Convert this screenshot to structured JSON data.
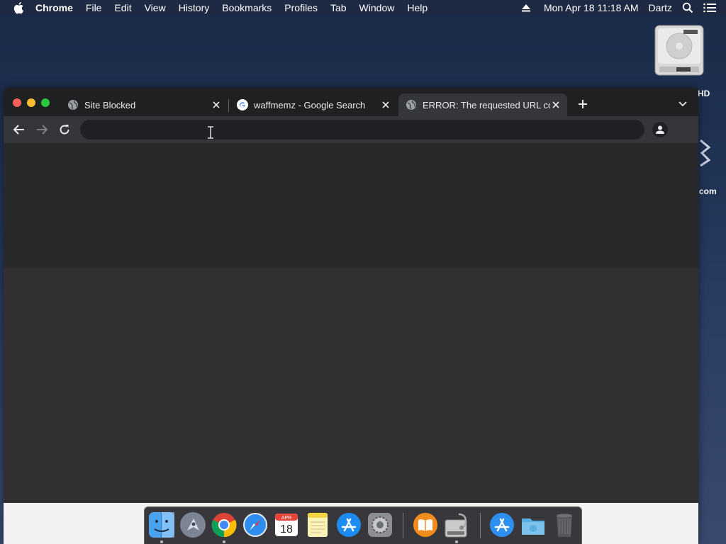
{
  "menubar": {
    "app_name": "Chrome",
    "items": [
      "File",
      "Edit",
      "View",
      "History",
      "Bookmarks",
      "Profiles",
      "Tab",
      "Window",
      "Help"
    ],
    "clock": "Mon Apr 18  11:18 AM",
    "user": "Dartz"
  },
  "desktop": {
    "hd_label": "HD",
    "label2": "com"
  },
  "browser": {
    "tabs": [
      {
        "title": "Site Blocked",
        "icon": "globe-icon",
        "active": false
      },
      {
        "title": "waffmemz - Google Search",
        "icon": "google-icon",
        "active": false
      },
      {
        "title": "ERROR: The requested URL co",
        "icon": "globe-icon",
        "active": true
      }
    ],
    "omnibox": {
      "value": "",
      "placeholder": ""
    }
  },
  "dock": {
    "items": [
      {
        "name": "finder",
        "running": true
      },
      {
        "name": "launchpad",
        "running": false
      },
      {
        "name": "chrome",
        "running": true
      },
      {
        "name": "safari",
        "running": false
      },
      {
        "name": "calendar",
        "month": "APR",
        "day": "18",
        "running": false
      },
      {
        "name": "notes",
        "running": false
      },
      {
        "name": "app-store",
        "running": false
      },
      {
        "name": "system-preferences",
        "running": false
      },
      {
        "name": "books",
        "running": false
      },
      {
        "name": "disk-utility",
        "running": true
      },
      {
        "name": "app-store-folder",
        "running": false
      },
      {
        "name": "downloads-folder",
        "running": false
      },
      {
        "name": "trash",
        "running": false
      }
    ]
  },
  "colors": {
    "traffic_red": "#fe5f57",
    "traffic_yellow": "#febc2e",
    "traffic_green": "#28c840",
    "chrome_dark": "#35363a"
  }
}
